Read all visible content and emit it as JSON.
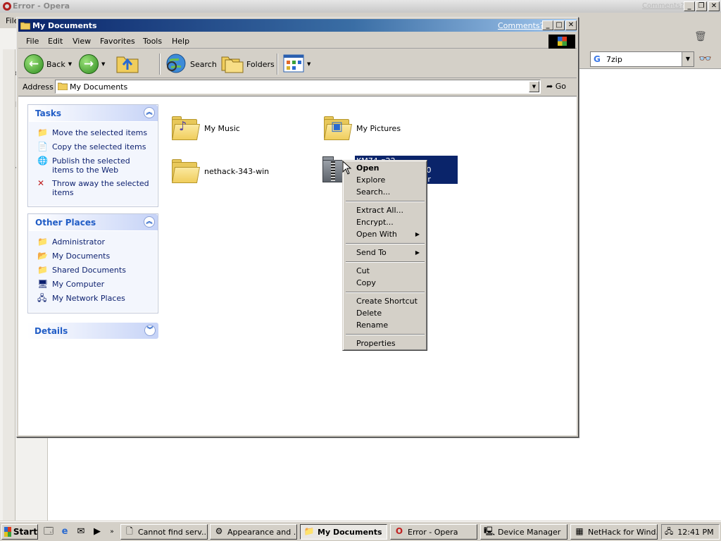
{
  "opera": {
    "title": "Error - Opera",
    "comments_link": "Comments?",
    "menu_file": "File",
    "side_labels": [
      "Bo",
      "I",
      "Tr",
      "H"
    ],
    "search_value": "7zip",
    "search_engine_glyph": "G"
  },
  "explorer": {
    "title": "My Documents",
    "comments_link": "Comments?",
    "menu": [
      "File",
      "Edit",
      "View",
      "Favorites",
      "Tools",
      "Help"
    ],
    "toolbar": {
      "back": "Back",
      "search": "Search",
      "folders": "Folders"
    },
    "address": {
      "label": "Address",
      "value": "My Documents",
      "go": "Go"
    },
    "tasks": {
      "header": "Tasks",
      "items": [
        {
          "label": "Move the selected items",
          "icon": "move-icon"
        },
        {
          "label": "Copy the selected items",
          "icon": "copy-icon"
        },
        {
          "label": "Publish the selected items to the Web",
          "icon": "publish-web-icon"
        },
        {
          "label": "Throw away the selected items",
          "icon": "delete-icon"
        }
      ]
    },
    "other_places": {
      "header": "Other Places",
      "items": [
        {
          "label": "Administrator",
          "icon": "folder-icon"
        },
        {
          "label": "My Documents",
          "icon": "documents-icon"
        },
        {
          "label": "Shared Documents",
          "icon": "folder-icon"
        },
        {
          "label": "My Computer",
          "icon": "computer-icon"
        },
        {
          "label": "My Network Places",
          "icon": "network-icon"
        }
      ]
    },
    "details": {
      "header": "Details"
    },
    "files": [
      {
        "name": "My Music"
      },
      {
        "name": "My Pictures"
      },
      {
        "name": "nethack-343-win"
      },
      {
        "name": "KM74-g22-20210814.win2000",
        "type": "Compressed Folder",
        "selected": true
      }
    ]
  },
  "context_menu": {
    "items": [
      "Open",
      "Explore",
      "Search...",
      "Extract All...",
      "Encrypt...",
      "Open With",
      "Send To",
      "Cut",
      "Copy",
      "Create Shortcut",
      "Delete",
      "Rename",
      "Properties"
    ]
  },
  "taskbar": {
    "start": "Start",
    "tasks": [
      {
        "label": "Cannot find serv...",
        "icon": "ie-page-icon"
      },
      {
        "label": "Appearance and ...",
        "icon": "control-panel-icon"
      },
      {
        "label": "My Documents",
        "icon": "folder-icon",
        "active": true
      },
      {
        "label": "Error - Opera",
        "icon": "opera-icon"
      },
      {
        "label": "Device Manager",
        "icon": "device-manager-icon"
      },
      {
        "label": "NetHack for Wind...",
        "icon": "nethack-icon"
      }
    ],
    "clock": "12:41 PM"
  }
}
